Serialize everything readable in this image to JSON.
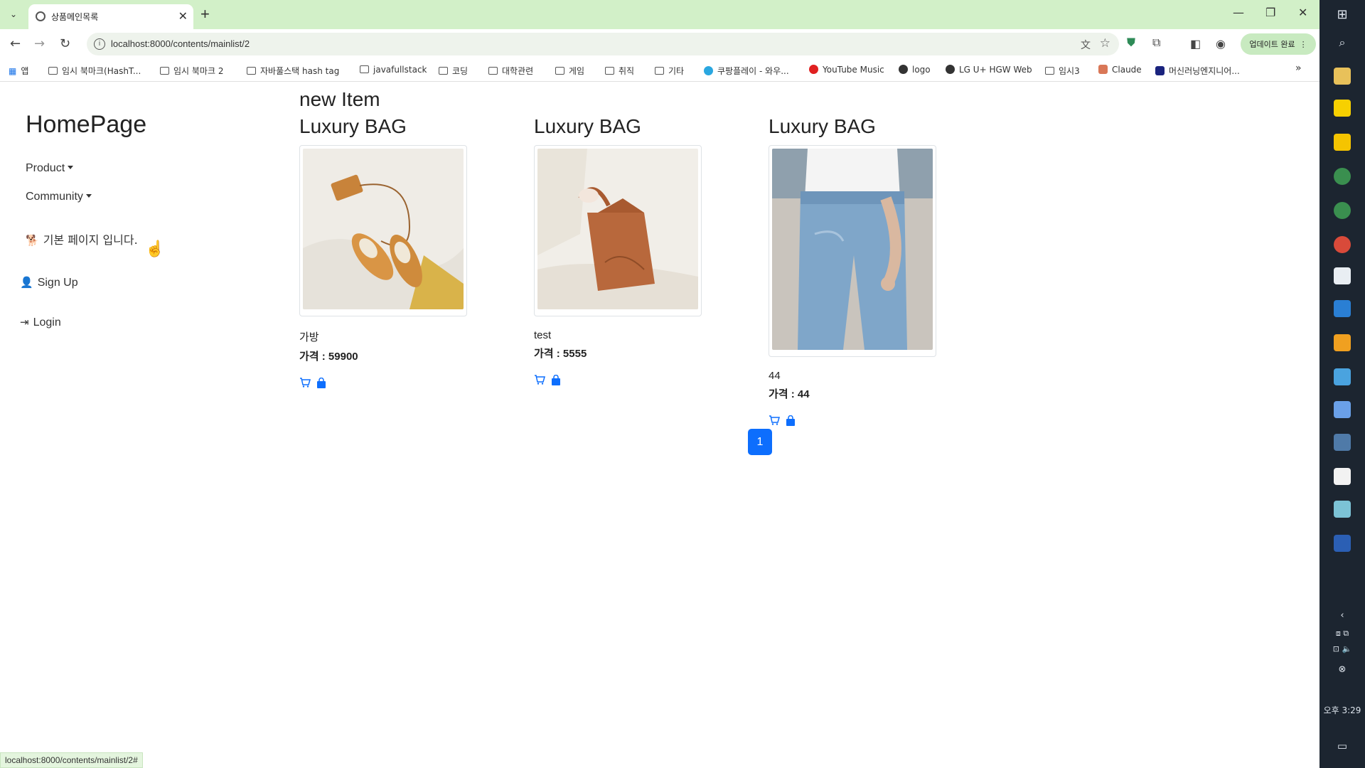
{
  "browser": {
    "tab_title": "상품메인목록",
    "url": "localhost:8000/contents/mainlist/2",
    "update_label": "업데이트 완료",
    "bookmarks": [
      {
        "label": "앱",
        "icon": "apps-icon"
      },
      {
        "label": "임시 북마크(HashT...",
        "icon": "folder-icon"
      },
      {
        "label": "임시 북마크 2",
        "icon": "folder-icon"
      },
      {
        "label": "자바풀스택 hash tag",
        "icon": "folder-icon"
      },
      {
        "label": "javafullstack",
        "icon": "folder-icon"
      },
      {
        "label": "코딩",
        "icon": "folder-icon"
      },
      {
        "label": "대학관련",
        "icon": "folder-icon"
      },
      {
        "label": "게임",
        "icon": "folder-icon"
      },
      {
        "label": "취직",
        "icon": "folder-icon"
      },
      {
        "label": "기타",
        "icon": "folder-icon"
      },
      {
        "label": "쿠팡플레이 - 와우...",
        "icon": "coupang-icon"
      },
      {
        "label": "YouTube Music",
        "icon": "youtube-music-icon"
      },
      {
        "label": "logo",
        "icon": "globe-icon"
      },
      {
        "label": "LG U+ HGW Web",
        "icon": "globe-icon"
      },
      {
        "label": "임시3",
        "icon": "folder-icon"
      },
      {
        "label": "Claude",
        "icon": "claude-icon"
      },
      {
        "label": "머신러닝엔지니어...",
        "icon": "j-icon"
      }
    ],
    "status_url": "localhost:8000/contents/mainlist/2#"
  },
  "sidebar": {
    "brand": "HomePage",
    "product": "Product",
    "community": "Community",
    "home_text": "기본 페이지 입니다.",
    "signup": "Sign Up",
    "login": "Login"
  },
  "main": {
    "section_title": "new Item",
    "items": [
      {
        "title": "Luxury BAG",
        "name": "가방",
        "price": "가격 : 59900",
        "photo": "shoes-and-bag-photo"
      },
      {
        "title": "Luxury BAG",
        "name": "test",
        "price": "가격 : 5555",
        "photo": "brown-bag-photo"
      },
      {
        "title": "Luxury BAG",
        "name": "44",
        "price": "가격 : 44",
        "photo": "jeans-photo"
      }
    ],
    "page": "1"
  },
  "taskbar": {
    "time": "오후 3:29"
  },
  "colors": {
    "accent": "#0d6efd",
    "tabbar": "#d2f0c8",
    "taskbar": "#1c2530"
  }
}
